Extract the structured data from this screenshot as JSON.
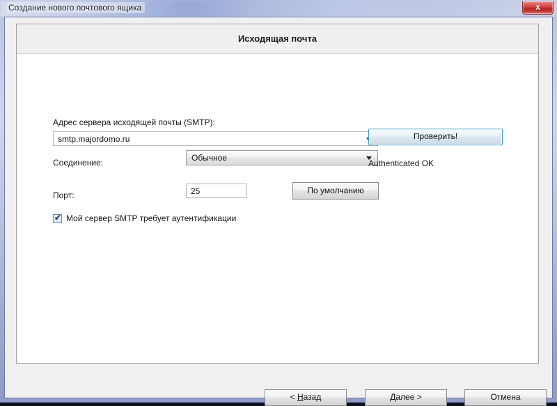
{
  "window": {
    "title": "Создание нового почтового ящика",
    "close_glyph": "x",
    "close_name": "Закрыть"
  },
  "header": {
    "title": "Исходящая почта"
  },
  "form": {
    "smtp": {
      "label": "Адрес сервера исходящей почты (SMTP):",
      "value": "smtp.majordomo.ru"
    },
    "connection": {
      "label": "Соединение:",
      "value": "Обычное"
    },
    "port": {
      "label": "Порт:",
      "value": "25",
      "default_button": "По умолчанию"
    },
    "auth": {
      "checkbox_label": "Мой сервер SMTP требует аутентификации",
      "checked": true,
      "check_glyph": "✔"
    }
  },
  "actions": {
    "check_button": "Проверить!",
    "status": "Authenticated OK"
  },
  "footer": {
    "back": {
      "prefix": "< ",
      "accel": "Н",
      "rest": "азад"
    },
    "next": {
      "accel": "Д",
      "rest": "алее",
      "suffix": "  >"
    },
    "cancel": "Отмена"
  },
  "colors": {
    "accent_focus": "#3c9cc4",
    "close_red": "#cf3e3c",
    "panel": "#ffffff",
    "header_band": "#efefef",
    "frame": "#6d79a8"
  }
}
